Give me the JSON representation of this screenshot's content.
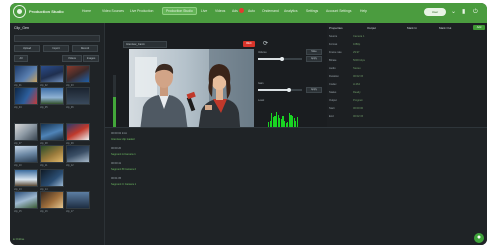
{
  "topbar": {
    "app_title": "Production Studio",
    "nav": [
      "Home",
      "Video Sources",
      "Live Production",
      "Production Studio",
      "Live",
      "Videos",
      "Ads",
      "Auto",
      "Ondemand",
      "Analytics",
      "Settings",
      "Account Settings",
      "Help"
    ],
    "active_index": 3,
    "user_label": "User"
  },
  "left_panel": {
    "title": "Clip_Gen",
    "buttons_row1": [
      "Upload",
      "Import",
      "Record"
    ],
    "buttons_row2": [
      "All",
      "Videos",
      "Images"
    ],
    "thumb_labels": [
      "clip_01",
      "clip_02",
      "clip_03",
      "clip_04",
      "clip_05",
      "clip_06",
      "clip_07",
      "clip_08",
      "clip_09",
      "clip_10",
      "clip_11",
      "clip_12",
      "clip_13",
      "clip_14",
      "clip_15",
      "clip_16",
      "clip_17"
    ],
    "footer": "● Online"
  },
  "center": {
    "clip_name": "Interview_Cam1",
    "rec_label": "REC",
    "controls": {
      "volume_label": "Volume",
      "gain_label": "Gain",
      "mute_label": "Mute",
      "apply_label": "Apply",
      "level_label": "Level",
      "volume": 0.55,
      "gain": 0.7
    },
    "audio_levels": [
      0.55,
      0.6,
      0.9,
      0.75,
      0.8,
      0.95,
      0.85,
      0.7,
      0.65,
      0.8,
      0.6,
      0.5,
      0.55,
      0.9,
      0.85,
      0.8,
      0.7,
      0.6,
      0.75
    ],
    "meter_level": 0.68
  },
  "right_panel": {
    "headers": [
      "Properties",
      "Output",
      "Mark In",
      "Mark Out"
    ],
    "add_label": "Add",
    "rows": [
      {
        "key": "Source",
        "val": "Camera 1"
      },
      {
        "key": "Format",
        "val": "1080p"
      },
      {
        "key": "Frame rate",
        "val": "29.97"
      },
      {
        "key": "Bitrate",
        "val": "5000 kbps"
      },
      {
        "key": "Audio",
        "val": "Stereo"
      },
      {
        "key": "Duration",
        "val": "00:02:15"
      },
      {
        "key": "Codec",
        "val": "H.264"
      },
      {
        "key": "Status",
        "val": "Ready"
      },
      {
        "key": "Output",
        "val": "Program"
      },
      {
        "key": "Start",
        "val": "00:00:00"
      },
      {
        "key": "End",
        "val": "00:02:15"
      }
    ]
  },
  "log": {
    "lines": [
      {
        "text": "00:00:02  Intro",
        "green": false
      },
      {
        "text": "Interview clip loaded",
        "green": true
      },
      {
        "text": "00:00:20",
        "green": false
      },
      {
        "text": "Segment A   Camera 1",
        "green": true
      },
      {
        "text": "00:00:41",
        "green": false
      },
      {
        "text": "Segment B   Camera 2",
        "green": true
      },
      {
        "text": "00:01:05",
        "green": false
      },
      {
        "text": "Segment C   Camera 1",
        "green": true
      }
    ]
  },
  "colors": {
    "brand": "#4b9c3f",
    "record": "#d8342a",
    "meter": "#19d422"
  }
}
